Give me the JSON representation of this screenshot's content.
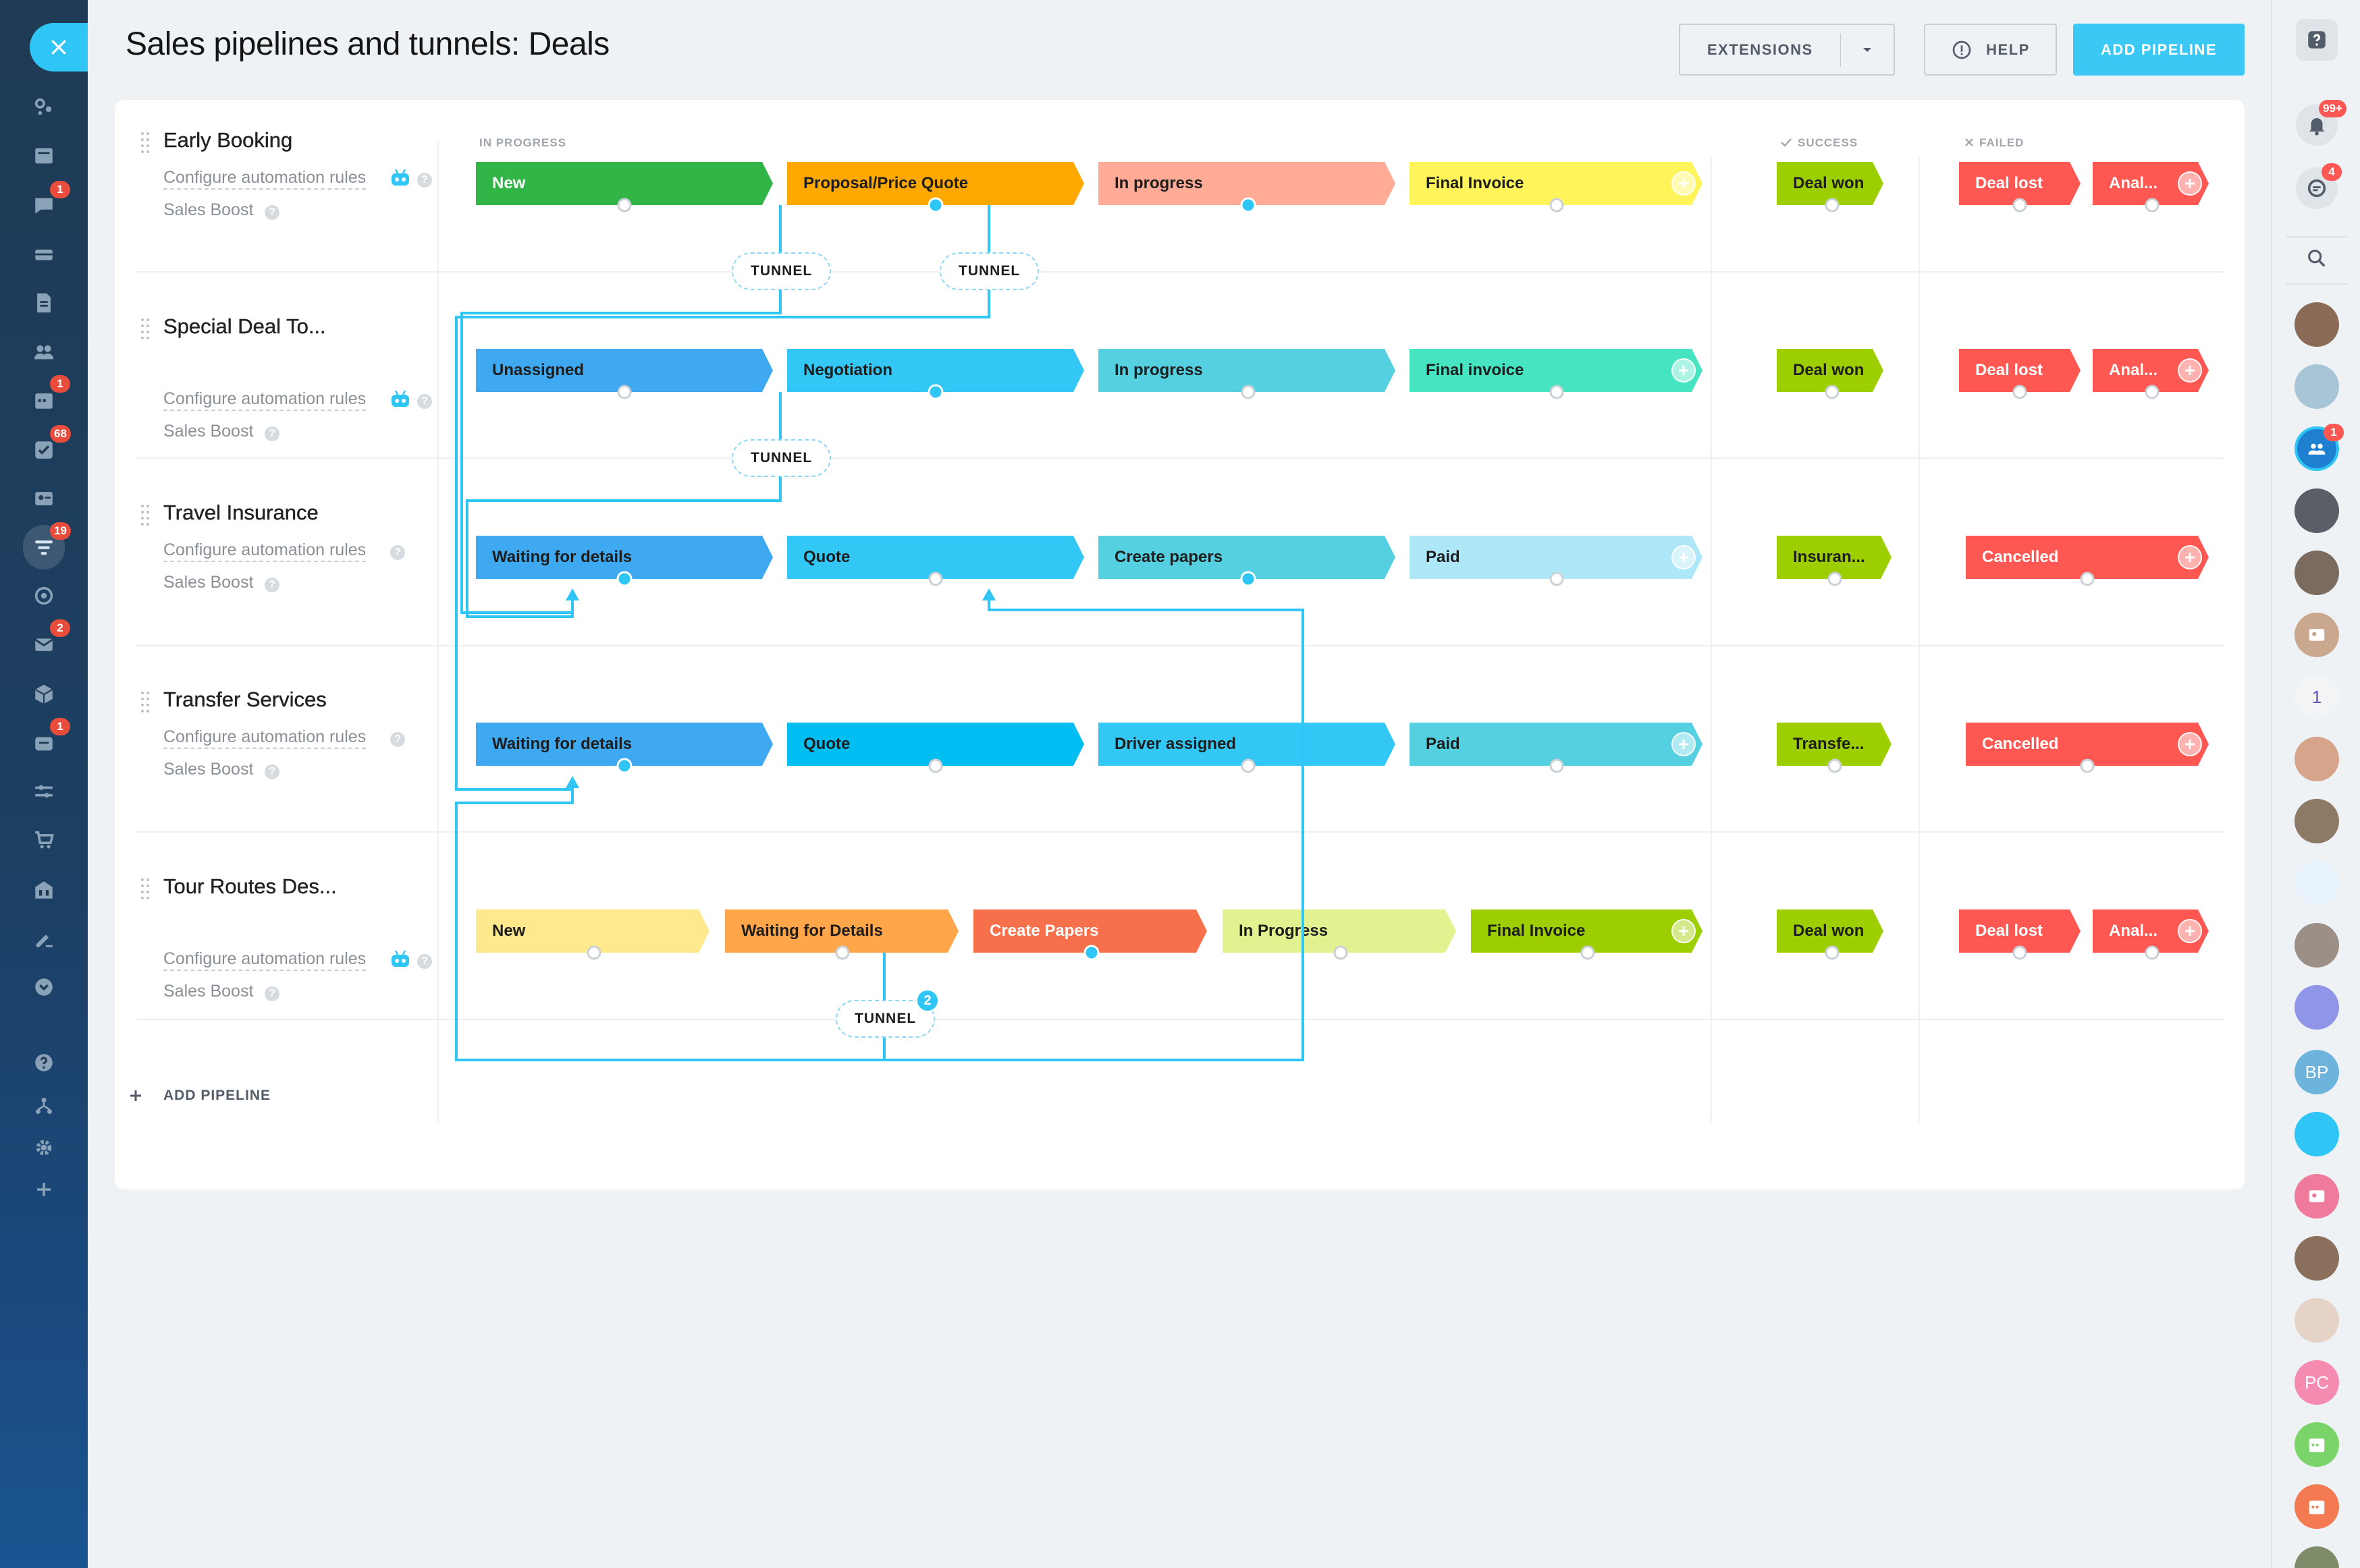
{
  "header": {
    "title": "Sales pipelines and tunnels: Deals",
    "extensions_label": "EXTENSIONS",
    "help_label": "HELP",
    "add_pipeline_label": "ADD PIPELINE"
  },
  "columns": {
    "in_progress": "IN PROGRESS",
    "success": "SUCCESS",
    "failed": "FAILED"
  },
  "links": {
    "automation": "Configure automation rules",
    "sales_boost": "Sales Boost"
  },
  "pipelines": [
    {
      "name": "Early Booking",
      "stages": [
        "New",
        "Proposal/Price Quote",
        "In progress",
        "Final Invoice"
      ],
      "success": "Deal won",
      "failed": [
        "Deal lost",
        "Anal..."
      ]
    },
    {
      "name": "Special Deal To...",
      "stages": [
        "Unassigned",
        "Negotiation",
        "In progress",
        "Final invoice"
      ],
      "success": "Deal won",
      "failed": [
        "Deal lost",
        "Anal..."
      ]
    },
    {
      "name": "Travel Insurance",
      "stages": [
        "Waiting for details",
        "Quote",
        "Create papers",
        "Paid"
      ],
      "success": "Insuran...",
      "failed": [
        "Cancelled"
      ]
    },
    {
      "name": "Transfer Services",
      "stages": [
        "Waiting for details",
        "Quote",
        "Driver assigned",
        "Paid"
      ],
      "success": "Transfe...",
      "failed": [
        "Cancelled"
      ]
    },
    {
      "name": "Tour Routes Des...",
      "stages": [
        "New",
        "Waiting for Details",
        "Create Papers",
        "In Progress",
        "Final Invoice"
      ],
      "success": "Deal won",
      "failed": [
        "Deal lost",
        "Anal..."
      ]
    }
  ],
  "tunnels": {
    "label": "TUNNEL",
    "badge_count": "2"
  },
  "footer": {
    "add_pipeline": "ADD PIPELINE"
  },
  "left_nav": {
    "badges": [
      "1",
      "1",
      "68",
      "19",
      "2",
      "1"
    ]
  },
  "right_nav": {
    "notifications_badge": "99+",
    "chat_badge": "4",
    "group_badge": "1",
    "avatar_bp": "BP",
    "avatar_pc": "PC"
  },
  "colors": {
    "accent": "#2fc6f6",
    "success": "#9dcf00",
    "failed": "#ff5752"
  }
}
